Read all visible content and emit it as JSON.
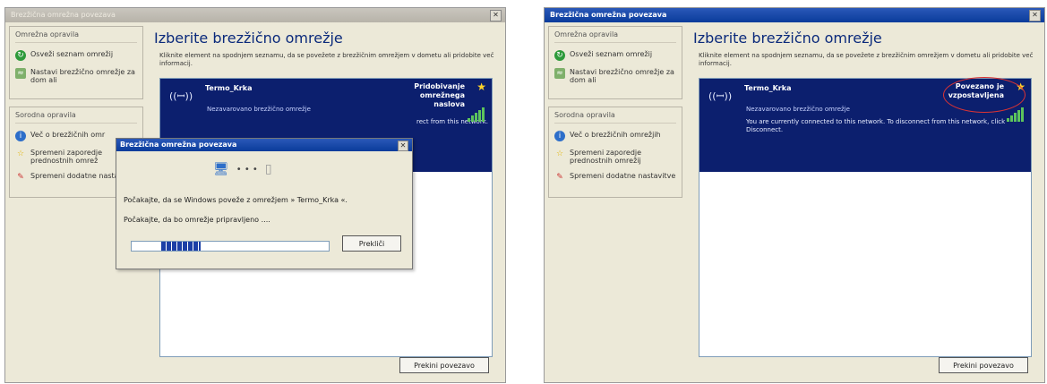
{
  "left": {
    "title": "Brezžična omrežna povezava",
    "sidebar": {
      "network_tasks_title": "Omrežna opravila",
      "tasks": [
        "Osveži seznam omrežij",
        "Nastavi brezžično omrežje za dom ali"
      ],
      "related_title": "Sorodna opravila",
      "related": [
        "Več o brezžičnih omr",
        "Spremeni zaporedje prednostnih omrež",
        "Spremeni dodatne nastavitve"
      ]
    },
    "heading": "Izberite brezžično omrežje",
    "instruction": "Kliknite element na spodnjem seznamu, da se povežete z brezžičnim omrežjem v dometu ali pridobite več informacij.",
    "network": {
      "ssid": "Termo_Krka",
      "security": "Nezavarovano brezžično omrežje",
      "message": "rect from this network.",
      "status": "Pridobivanje omrežnega naslova"
    },
    "connect_button": "Prekini povezavo",
    "dialog": {
      "title": "Brezžična omrežna povezava",
      "line1": "Počakajte, da se Windows poveže z omrežjem » Termo_Krka «.",
      "line2": "Počakajte, da bo omrežje pripravljeno ....",
      "cancel": "Prekliči"
    }
  },
  "right": {
    "title": "Brezžična omrežna povezava",
    "sidebar": {
      "network_tasks_title": "Omrežna opravila",
      "tasks": [
        "Osveži seznam omrežij",
        "Nastavi brezžično omrežje za dom ali"
      ],
      "related_title": "Sorodna opravila",
      "related": [
        "Več o brezžičnih omrežjih",
        "Spremeni zaporedje prednostnih omrežij",
        "Spremeni dodatne nastavitve"
      ]
    },
    "heading": "Izberite brezžično omrežje",
    "instruction": "Kliknite element na spodnjem seznamu, da se povežete z brezžičnim omrežjem v dometu ali pridobite več informacij.",
    "network": {
      "ssid": "Termo_Krka",
      "security": "Nezavarovano brezžično omrežje",
      "message": "You are currently connected to this network. To disconnect from this network, click Disconnect.",
      "status": "Povezano je vzpostavljena"
    },
    "connect_button": "Prekini povezavo"
  },
  "icons": [
    "refresh-icon",
    "wireless-setup-icon",
    "info-icon",
    "star-icon",
    "settings-icon",
    "antenna-icon",
    "signal-bars-icon",
    "computer-icon",
    "close-icon"
  ],
  "colors": {
    "network_bg": "#0c1f6e",
    "star": "#ffd42a",
    "signal": "#5cc45c",
    "highlight_ring": "#dd3333"
  }
}
